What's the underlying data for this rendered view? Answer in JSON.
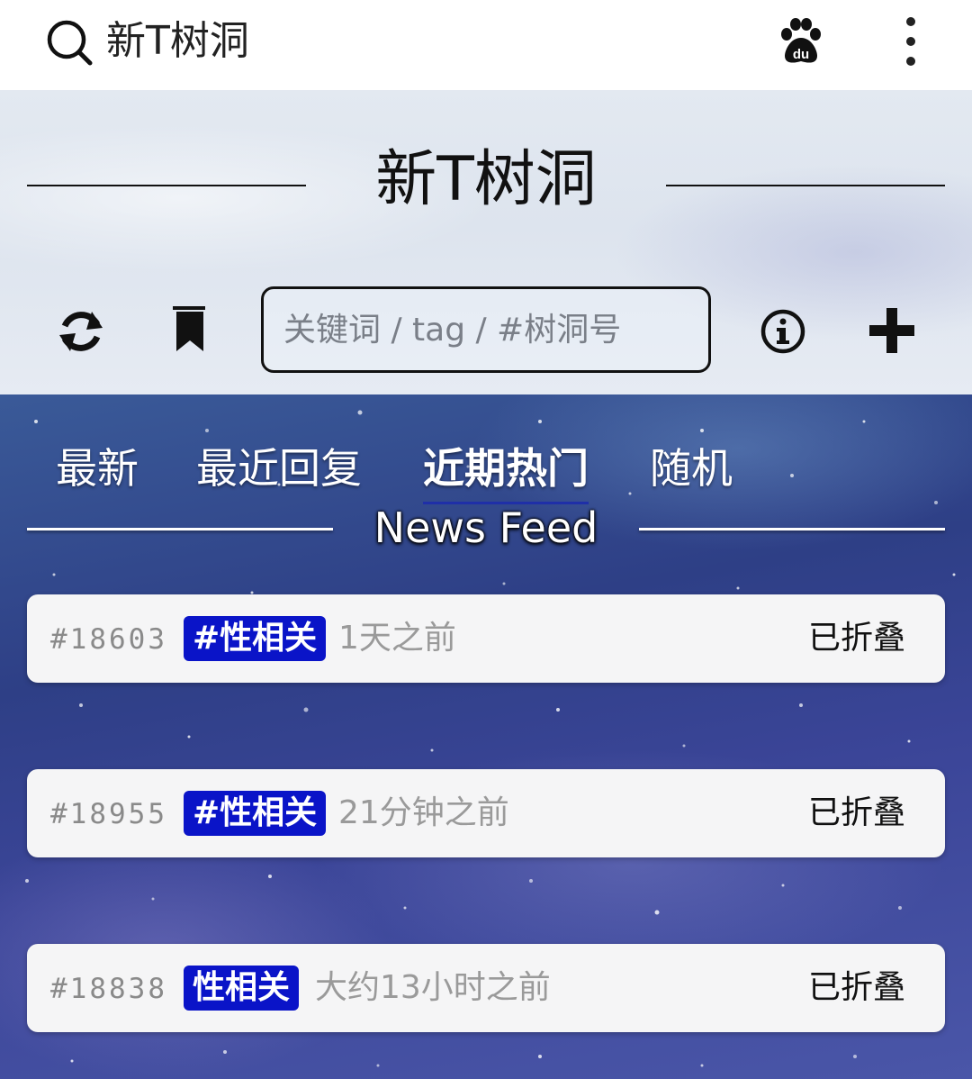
{
  "topbar": {
    "query": "新T树洞",
    "icons": [
      "search-icon",
      "baidu-paw-icon",
      "kebab-menu-icon"
    ]
  },
  "header": {
    "title": "新T树洞",
    "search_placeholder": "关键词 / tag / #树洞号",
    "icons": [
      "refresh-icon",
      "bookmark-icon",
      "info-icon",
      "plus-icon"
    ]
  },
  "tabs": [
    {
      "label": "最新",
      "active": false
    },
    {
      "label": "最近回复",
      "active": false
    },
    {
      "label": "近期热门",
      "active": true
    },
    {
      "label": "随机",
      "active": false
    }
  ],
  "feed_title": "News Feed",
  "posts": [
    {
      "id": "#18603",
      "tag": "#性相关",
      "time": "1天之前",
      "status": "已折叠"
    },
    {
      "id": "#18955",
      "tag": "#性相关",
      "time": "21分钟之前",
      "status": "已折叠"
    },
    {
      "id": "#18838",
      "tag": "性相关",
      "time": "大约13小时之前",
      "status": "已折叠"
    }
  ],
  "colors": {
    "tag_bg": "#0a14c8",
    "active_tab_underline": "#1f2fa8",
    "card_bg": "#f5f5f6"
  }
}
